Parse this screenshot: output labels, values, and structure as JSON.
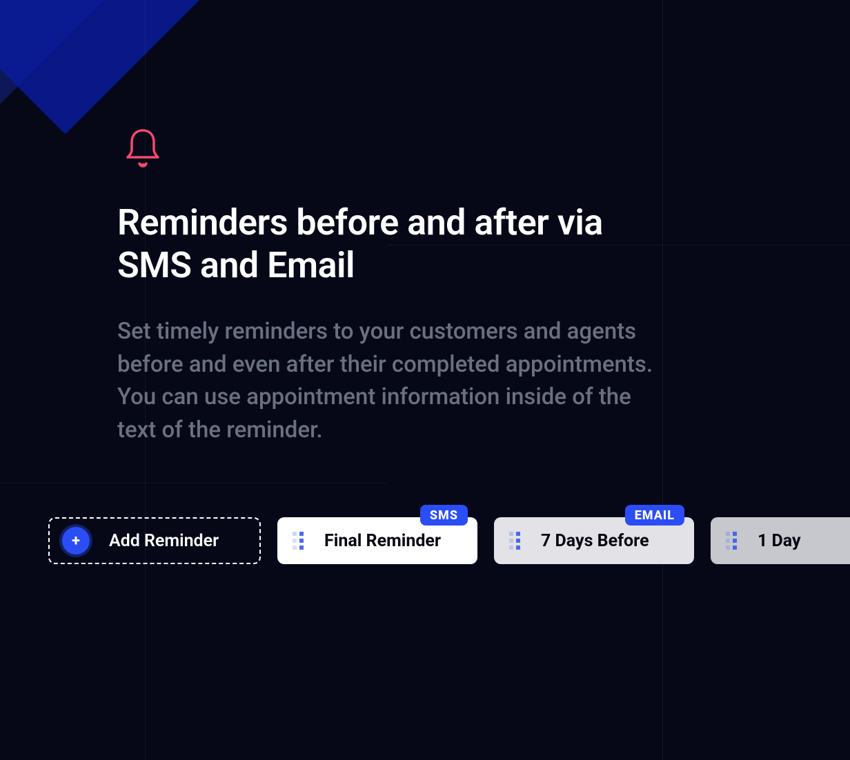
{
  "header": {
    "title": "Reminders before and after via SMS and Email",
    "subtitle": "Set timely reminders to your customers and agents before and even after their completed appointments. You can use appointment information inside of the text of the reminder."
  },
  "add_button": {
    "label": "Add Reminder"
  },
  "reminders": [
    {
      "label": "Final Reminder",
      "badge": "SMS"
    },
    {
      "label": "7 Days Before",
      "badge": "EMAIL"
    },
    {
      "label": "1 Day",
      "badge": ""
    }
  ],
  "colors": {
    "accent": "#2b4df5",
    "icon": "#f54a6b"
  }
}
